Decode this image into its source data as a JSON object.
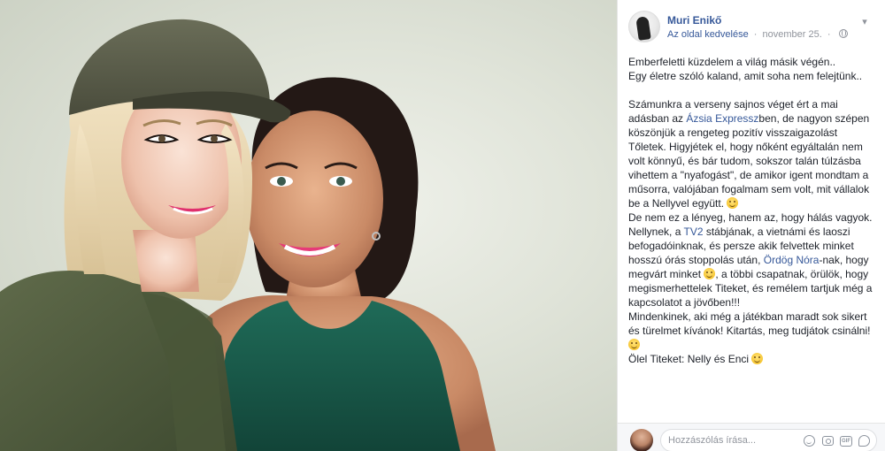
{
  "post": {
    "author": "Muri Enikő",
    "like_page": "Az oldal kedvelése",
    "separator": "·",
    "date": "november 25.",
    "menu_icon": "chevron-down-icon",
    "privacy_icon": "globe-icon",
    "text": {
      "l1": "Emberfeletti küzdelem a világ másik végén..",
      "l2": "Egy életre szóló kaland, amit soha nem felejtünk..",
      "p1a": "Számunkra a verseny sajnos véget ért a mai adásban az ",
      "p1link": "Ázsia Expressz",
      "p1b": "ben, de nagyon szépen köszönjük a rengeteg pozitív visszaigazolást Tőletek. Higyjétek el, hogy nőként egyáltalán nem volt könnyű, és bár tudom, sokszor talán túlzásba vihettem a \"nyafogást\", de amikor igent mondtam a műsorra, valójában fogalmam sem volt, mit vállalok be a Nellyvel együtt.",
      "p2": "De nem ez a lényeg, hanem az, hogy hálás vagyok.",
      "p3a": "Nellynek, a ",
      "p3link1": "TV2",
      "p3b": " stábjának, a vietnámi és laoszi befogadóinknak, és persze akik felvettek minket hosszú órás stoppolás után, ",
      "p3link2": "Ördög Nóra",
      "p3c": "-nak, hogy megvárt minket",
      "p3d": ", a többi csapatnak, örülök, hogy megismerhettelek Titeket, és remélem tartjuk még a kapcsolatot a jövőben!!!",
      "p4": "Mindenkinek, aki még a játékban maradt sok sikert és türelmet kívánok! Kitartás, meg tudjátok csinálni!",
      "p5": "Ölel Titeket: Nelly és Enci"
    }
  },
  "comment": {
    "placeholder": "Hozzászólás írása...",
    "icons": [
      "emoji-icon",
      "camera-icon",
      "gif-icon",
      "sticker-icon"
    ],
    "gif_label": "GIF"
  },
  "colors": {
    "link": "#365899",
    "meta": "#90949c",
    "text": "#1d2129"
  }
}
